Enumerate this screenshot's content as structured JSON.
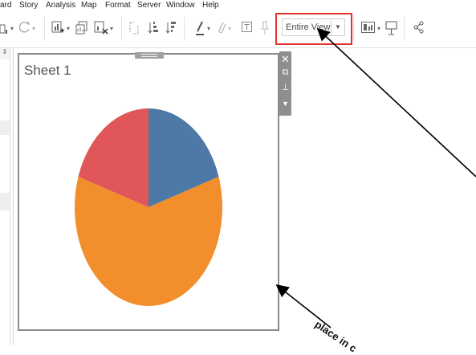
{
  "menu": [
    "ard",
    "Story",
    "Analysis",
    "Map",
    "Format",
    "Server",
    "Window",
    "Help"
  ],
  "toolbar": {
    "view_select": {
      "value": "Entire View"
    }
  },
  "sheet": {
    "title": "Sheet 1",
    "controls": [
      "close-icon",
      "popout-icon",
      "pin-icon",
      "more-icon"
    ]
  },
  "colors": {
    "blue": "#4e79a7",
    "orange": "#f28e2b",
    "red": "#e15759",
    "highlight": "#e8302a"
  },
  "chart_data": {
    "type": "pie",
    "slices": [
      {
        "color": "#4e79a7",
        "value": 20
      },
      {
        "color": "#f28e2b",
        "value": 60
      },
      {
        "color": "#e15759",
        "value": 20
      }
    ]
  },
  "annotation": {
    "text": "place in c"
  }
}
